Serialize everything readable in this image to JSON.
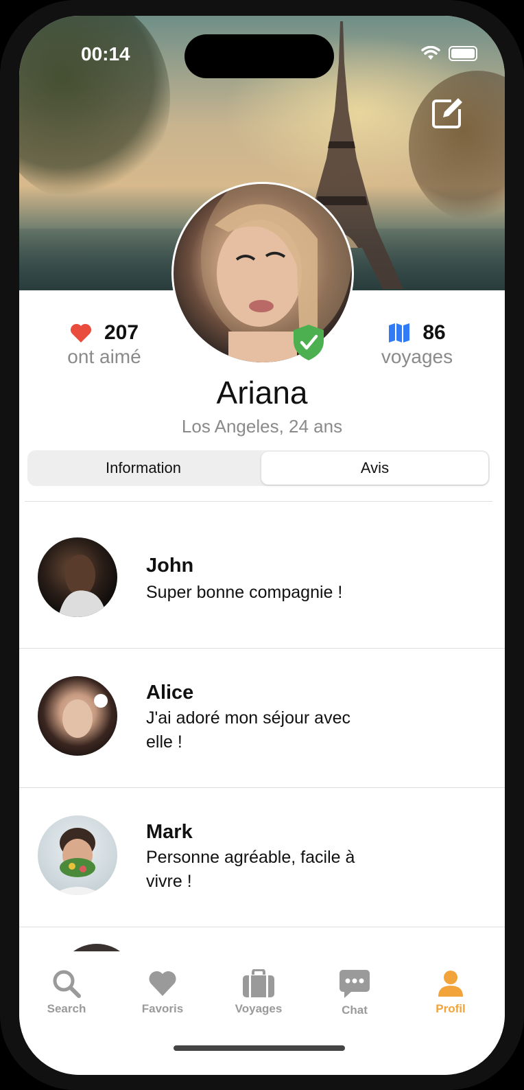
{
  "status_bar": {
    "time": "00:14"
  },
  "profile": {
    "name": "Ariana",
    "subtitle": "Los Angeles, 24 ans",
    "likes": {
      "value": "207",
      "label": "ont aimé",
      "icon": "heart-icon"
    },
    "trips": {
      "value": "86",
      "label": "voyages",
      "icon": "map-icon"
    },
    "verified_icon": "verified-shield-icon"
  },
  "segmented": {
    "tabs": [
      {
        "label": "Information",
        "active": false
      },
      {
        "label": "Avis",
        "active": true
      }
    ]
  },
  "reviews": [
    {
      "name": "John",
      "text": "Super bonne compagnie !"
    },
    {
      "name": "Alice",
      "text": "J'ai adoré mon séjour avec elle !"
    },
    {
      "name": "Mark",
      "text": "Personne agréable, facile à vivre !"
    }
  ],
  "tab_bar": {
    "items": [
      {
        "label": "Search",
        "icon": "search-icon",
        "active": false
      },
      {
        "label": "Favoris",
        "icon": "heart-icon",
        "active": false
      },
      {
        "label": "Voyages",
        "icon": "briefcase-icon",
        "active": false
      },
      {
        "label": "Chat",
        "icon": "chat-bubble-icon",
        "active": false
      },
      {
        "label": "Profil",
        "icon": "person-icon",
        "active": true
      }
    ]
  },
  "colors": {
    "accent": "#f2a33a",
    "heart": "#e94b3c",
    "map": "#2f7cf6",
    "verified": "#4caf50",
    "inactive": "#9a9a9a"
  }
}
